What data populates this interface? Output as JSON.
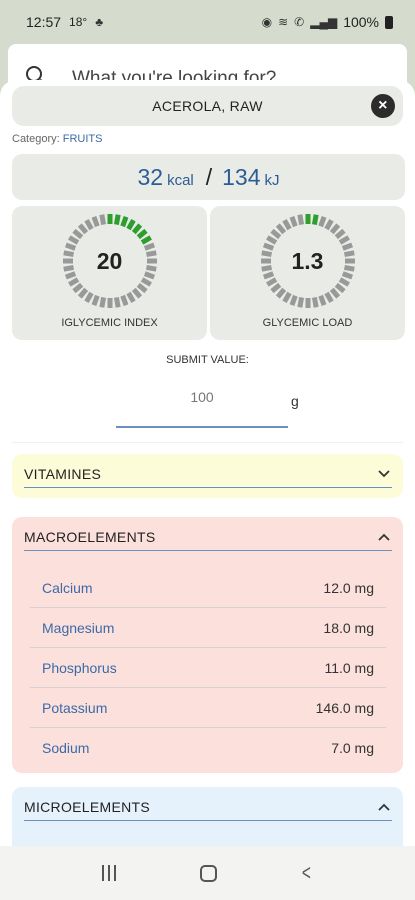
{
  "status": {
    "time": "12:57",
    "temp": "18°",
    "battery": "100%"
  },
  "search": {
    "placeholder": "What you're looking for?"
  },
  "food": {
    "title": "ACEROLA, RAW",
    "category_label": "Category:",
    "category_value": "FRUITS",
    "kcal": "32",
    "kcal_unit": "kcal",
    "kj": "134",
    "kj_unit": "kJ"
  },
  "glycemic_index": {
    "value": "20",
    "label": "IGLYCEMIC INDEX",
    "fill_fraction": 0.2
  },
  "glycemic_load": {
    "value": "1.3",
    "label": "GLYCEMIC LOAD",
    "fill_fraction": 0.05
  },
  "submit": {
    "label": "SUBMIT VALUE:",
    "value": "100",
    "unit": "g"
  },
  "sections": {
    "vitamines": {
      "title": "VITAMINES",
      "expanded": false,
      "color": "#fdfcd9"
    },
    "macroelements": {
      "title": "MACROELEMENTS",
      "expanded": true,
      "color": "#fbe0dc",
      "rows": [
        {
          "name": "Calcium",
          "amount": "12.0 mg"
        },
        {
          "name": "Magnesium",
          "amount": "18.0 mg"
        },
        {
          "name": "Phosphorus",
          "amount": "11.0 mg"
        },
        {
          "name": "Potassium",
          "amount": "146.0 mg"
        },
        {
          "name": "Sodium",
          "amount": "7.0 mg"
        }
      ]
    },
    "microelements": {
      "title": "MICROELEMENTS",
      "expanded": true,
      "color": "#e5f2fc"
    }
  },
  "colors": {
    "gauge_active": "#2e9e2e",
    "gauge_inactive": "#999999",
    "link": "#3c6aa8"
  }
}
